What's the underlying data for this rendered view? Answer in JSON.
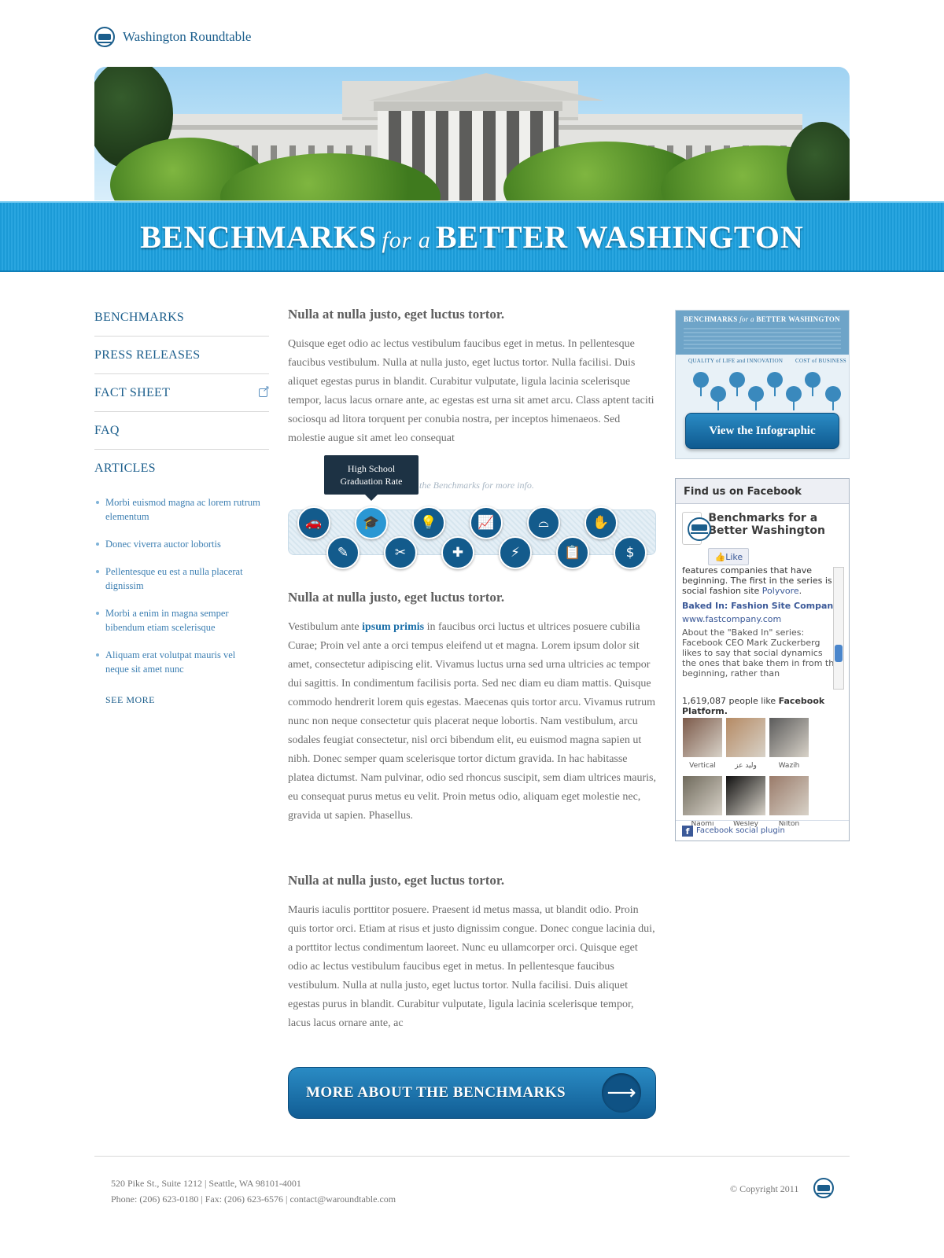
{
  "brand": {
    "name": "Washington Roundtable"
  },
  "banner": {
    "part1": "BENCHMARKS",
    "part2": "for a",
    "part3": "BETTER WASHINGTON"
  },
  "nav": [
    {
      "label": "BENCHMARKS"
    },
    {
      "label": "PRESS RELEASES"
    },
    {
      "label": "FACT SHEET",
      "icon": "external-link-icon"
    },
    {
      "label": "FAQ"
    },
    {
      "label": "ARTICLES"
    }
  ],
  "articles": [
    "Morbi euismod magna ac lorem rutrum elementum",
    "Donec viverra auctor lobortis",
    "Pellentesque eu est a nulla placerat dignissim",
    "Morbi a enim in magna semper bibendum etiam scelerisque",
    "Aliquam erat volutpat mauris vel neque sit amet nunc"
  ],
  "see_more": "SEE MORE",
  "sections": [
    {
      "heading": "Nulla at nulla justo, eget luctus tortor.",
      "body": "Quisque eget odio ac lectus vestibulum faucibus eget in metus. In pellentesque faucibus vestibulum. Nulla at nulla justo, eget luctus tortor. Nulla facilisi. Duis aliquet egestas purus in blandit. Curabitur vulputate, ligula lacinia scelerisque tempor, lacus lacus ornare ante, ac egestas est urna sit amet arcu. Class aptent taciti sociosqu ad litora torquent per conubia nostra, per inceptos himenaeos. Sed molestie augue sit amet leo consequat"
    },
    {
      "heading": "Nulla at nulla justo, eget luctus tortor.",
      "body_before": "Vestibulum ante ",
      "link": "ipsum primis",
      "body_after": " in faucibus orci luctus et ultrices posuere cubilia Curae; Proin vel ante a orci tempus eleifend ut et magna. Lorem ipsum dolor sit amet, consectetur adipiscing elit. Vivamus luctus urna sed urna ultricies ac tempor dui sagittis. In condimentum facilisis porta. Sed nec diam eu diam mattis. Quisque commodo hendrerit lorem quis egestas. Maecenas quis tortor arcu. Vivamus rutrum nunc non neque consectetur quis placerat neque lobortis. Nam vestibulum, arcu sodales feugiat consectetur, nisl orci bibendum elit, eu euismod magna sapien ut nibh. Donec semper quam scelerisque tortor dictum gravida. In hac habitasse platea dictumst. Nam pulvinar, odio sed rhoncus suscipit, sem diam ultrices mauris, eu consequat purus metus eu velit. Proin metus odio, aliquam eget molestie nec, gravida ut sapien. Phasellus."
    },
    {
      "heading": "Nulla at nulla justo, eget luctus tortor.",
      "body": "Mauris iaculis porttitor posuere. Praesent id metus massa, ut blandit odio. Proin quis tortor orci. Etiam at risus et justo dignissim congue. Donec congue lacinia dui, a porttitor lectus condimentum laoreet. Nunc eu ullamcorper orci. Quisque eget odio ac lectus vestibulum faucibus eget in metus. In pellentesque faucibus vestibulum. Nulla at nulla justo, eget luctus tortor. Nulla facilisi. Duis aliquet egestas purus in blandit. Curabitur vulputate, ligula lacinia scelerisque tempor, lacus lacus ornare ante, ac"
    }
  ],
  "benchmarks": {
    "hint": "the Benchmarks for more info.",
    "tooltip_line1": "High School",
    "tooltip_line2": "Graduation Rate",
    "icons": [
      {
        "name": "car-icon",
        "glyph": "🚗"
      },
      {
        "name": "pencil-icon",
        "glyph": "✎"
      },
      {
        "name": "graduation-cap-icon",
        "glyph": "🎓",
        "active": true
      },
      {
        "name": "tools-icon",
        "glyph": "✂"
      },
      {
        "name": "lightbulb-icon",
        "glyph": "💡"
      },
      {
        "name": "bandage-icon",
        "glyph": "✚"
      },
      {
        "name": "chart-icon",
        "glyph": "📈"
      },
      {
        "name": "power-icon",
        "glyph": "⚡"
      },
      {
        "name": "bridge-icon",
        "glyph": "⌓"
      },
      {
        "name": "clipboard-icon",
        "glyph": "📋"
      },
      {
        "name": "handshake-icon",
        "glyph": "✋"
      },
      {
        "name": "money-bag-icon",
        "glyph": "$"
      }
    ]
  },
  "cta": {
    "label": "MORE ABOUT THE BENCHMARKS",
    "arrow": "⟶"
  },
  "infographic": {
    "title_left": "BENCHMARKS",
    "title_mid": "for a",
    "title_right": "BETTER WASHINGTON",
    "sub1": "QUALITY of LIFE and INNOVATION",
    "sub2": "COST of BUSINESS",
    "button": "View the Infographic"
  },
  "facebook": {
    "header": "Find us on Facebook",
    "page_name": "Benchmarks for a Better Washington",
    "like": "Like",
    "stream_line1": "features companies that have beginning. The first in the series is social fashion site ",
    "stream_link1": "Polyvore",
    "stream_dot": ".",
    "stream_title": "Baked In: Fashion Site Company",
    "stream_url": "www.fastcompany.com",
    "stream_body": "About the \"Baked In\" series: Facebook CEO Mark Zuckerberg likes to say that social dynamics the ones that bake them in from the beginning, rather than",
    "count_text": "1,619,087 people like ",
    "count_link": "Facebook Platform.",
    "fans": [
      {
        "name": "Vertical",
        "color": "#7c5a4a"
      },
      {
        "name": "وليد عز",
        "color": "#b58a64"
      },
      {
        "name": "Wazih",
        "color": "#5b5b5b"
      },
      {
        "name": "Naomi",
        "color": "#6f6a5c"
      },
      {
        "name": "Wesley",
        "color": "#111111"
      },
      {
        "name": "Nilton",
        "color": "#9a7b6a"
      }
    ],
    "footer": "Facebook social plugin"
  },
  "footer": {
    "address": "520 Pike St., Suite 1212 | Seattle, WA 98101-4001",
    "contact": "Phone: (206) 623-0180 | Fax: (206) 623-6576 | contact@waroundtable.com",
    "copyright": "© Copyright 2011"
  }
}
